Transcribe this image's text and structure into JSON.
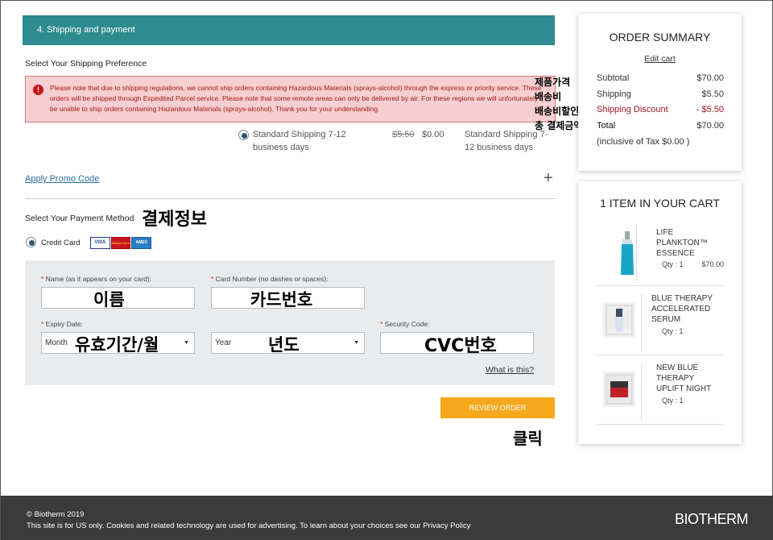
{
  "section": {
    "header": "4. Shipping and payment"
  },
  "shipping": {
    "preference_label": "Select Your Shipping Preference",
    "alert_icon": "!",
    "alert_text": "Please note that due to shipping regulations, we cannot ship orders containing Hazardous Materials (sprays-alcohol) through the express or priority service. These orders will be shipped through Expedited Parcel service. Please note that some remote areas can only be delivered by air. For these regions we will unfortunately be unable to ship orders containing Hazardous Materials (sprays-alcohol). Thank you for your understanding.",
    "option_label": "Standard Shipping 7-12 business days",
    "old_price": "$5.50",
    "new_price": "$0.00",
    "option_summary": "Standard Shipping 7-12 business days"
  },
  "promo": {
    "link": "Apply Promo Code",
    "expand_icon": "+"
  },
  "payment": {
    "method_label": "Select Your Payment Method",
    "credit_card_label": "Credit Card",
    "card_logos": [
      "VISA",
      "MasterCard",
      "AMEX"
    ],
    "fields": {
      "name_label": "Name (as it appears on your card):",
      "card_number_label": "Card Number (no dashes or spaces):",
      "expiry_label": "Expiry Date:",
      "security_label": "Security Code:",
      "month_value": "Month",
      "year_value": "Year",
      "what_is_this": "What is this?"
    },
    "review_button": "REVIEW ORDER"
  },
  "annotations": {
    "product_price": "제품가격",
    "shipping_fee": "배송비",
    "shipping_discount": "배송비할인",
    "total_amount": "총 결제금액",
    "payment_info": "결제정보",
    "name": "이름",
    "card_number": "카드번호",
    "expiry_month": "유효기간/월",
    "year": "년도",
    "cvc": "CVC번호",
    "click": "클릭"
  },
  "order_summary": {
    "title": "ORDER SUMMARY",
    "edit_cart": "Edit cart",
    "rows": [
      {
        "label": "Subtotal",
        "value": "$70.00"
      },
      {
        "label": "Shipping",
        "value": "$5.50"
      },
      {
        "label": "Shipping Discount",
        "value": "- $5.50"
      },
      {
        "label": "Total",
        "value": "$70.00"
      }
    ],
    "tax_note": "(inclusive of Tax $0.00 )",
    "discount_color": "#a0171d"
  },
  "cart": {
    "title": "1 ITEM IN YOUR CART",
    "items": [
      {
        "name": "LIFE PLANKTON™ ESSENCE",
        "qty": "Qty : 1",
        "price": "$70.00"
      },
      {
        "name": "BLUE THERAPY ACCELERATED SERUM",
        "qty": "Qty : 1",
        "price": ""
      },
      {
        "name": "NEW BLUE THERAPY UPLIFT NIGHT",
        "qty": "Qty : 1",
        "price": ""
      }
    ]
  },
  "footer": {
    "copyright": "© Biotherm 2019",
    "notice": "This site is for US only. Cookies and related technology are used for advertising. To learn about your choices see our Privacy Policy",
    "logo": "BIOTHERM"
  },
  "colors": {
    "header_teal": "#2e8b8f",
    "review_orange": "#f5a81c",
    "alert_red": "#c8171e"
  }
}
